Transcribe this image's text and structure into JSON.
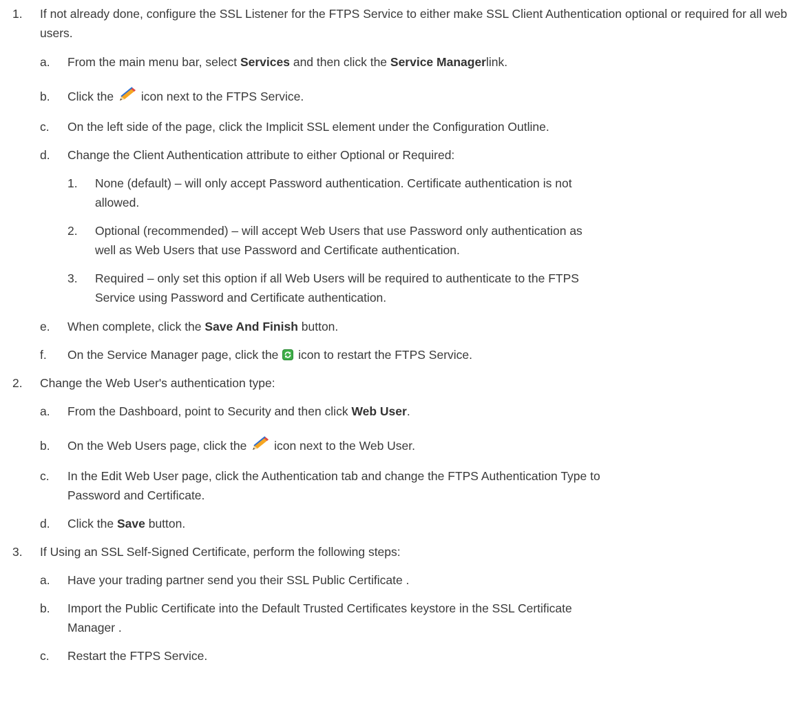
{
  "steps": [
    {
      "num": "1.",
      "text": "If not already done, configure the SSL Listener for the FTPS Service to either make SSL Client Authentication optional or required for all web users.",
      "substeps": [
        {
          "num": "a.",
          "pre": "From the main menu bar, select ",
          "b1": "Services",
          "mid": " and then click the ",
          "b2": "Service Manager",
          "post": "link."
        },
        {
          "num": "b.",
          "pre": "Click the ",
          "post": " icon next to the FTPS Service."
        },
        {
          "num": "c.",
          "text": "On the left side of the page, click the Implicit SSL element under the Configuration Outline."
        },
        {
          "num": "d.",
          "text": "Change the Client Authentication attribute to either Optional or Required:",
          "items": [
            {
              "num": "1.",
              "line1": "None (default) – will only accept Password authentication. Certificate authentication is not",
              "line2": "allowed."
            },
            {
              "num": "2.",
              "line1": "Optional (recommended) – will accept Web Users that use Password only authentication as",
              "line2": "well as Web Users that use Password and Certificate authentication."
            },
            {
              "num": "3.",
              "line1": "Required – only set this option if all Web Users will be required to authenticate to the FTPS",
              "line2": "Service using Password and Certificate authentication."
            }
          ]
        },
        {
          "num": "e.",
          "pre": "When complete, click the ",
          "b1": "Save And Finish",
          "post": " button."
        },
        {
          "num": "f.",
          "pre": "On the Service Manager page, click the ",
          "post": " icon to restart the FTPS Service."
        }
      ]
    },
    {
      "num": "2.",
      "text": "Change the Web User's authentication type:",
      "substeps": [
        {
          "num": "a.",
          "pre": "From the Dashboard, point to Security and then click ",
          "b1": "Web User",
          "post": "."
        },
        {
          "num": "b.",
          "pre": "On the Web Users page, click the ",
          "post": " icon next to the Web User."
        },
        {
          "num": "c.",
          "line1": "In the Edit Web User page, click the Authentication tab and change the FTPS Authentication Type to",
          "line2": "Password and Certificate."
        },
        {
          "num": "d.",
          "pre": "Click the ",
          "b1": "Save",
          "post": " button."
        }
      ]
    },
    {
      "num": "3.",
      "text": "If Using an SSL Self-Signed Certificate, perform the following steps:",
      "substeps": [
        {
          "num": "a.",
          "text": "Have your trading partner send you their SSL Public Certificate ."
        },
        {
          "num": "b.",
          "line1": "Import the Public Certificate into the Default Trusted Certificates keystore in the SSL Certificate",
          "line2": "Manager ."
        },
        {
          "num": "c.",
          "text": "Restart the FTPS Service."
        }
      ]
    }
  ]
}
